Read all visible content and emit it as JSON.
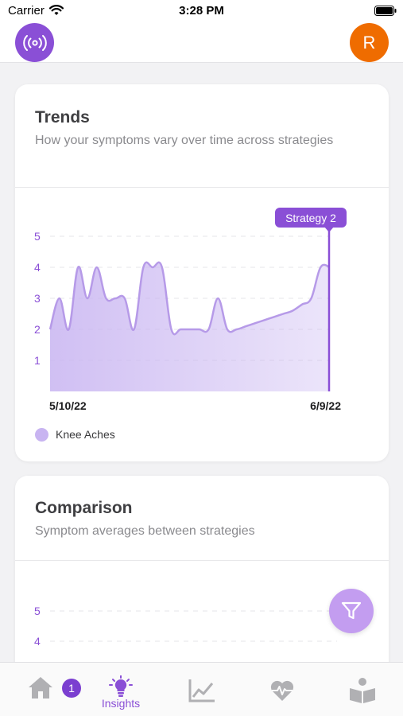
{
  "status_bar": {
    "carrier": "Carrier",
    "time": "3:28 PM"
  },
  "header": {
    "avatar_initial": "R"
  },
  "trends": {
    "title": "Trends",
    "subtitle": "How your symptoms vary over time across strategies",
    "legend_label": "Knee Aches",
    "colors": {
      "accent": "#8a4fd6",
      "area": "#c8b4f1",
      "line": "#b69ae8"
    }
  },
  "chart_data": [
    {
      "type": "area",
      "title": "",
      "x_start_label": "5/10/22",
      "x_end_label": "6/9/22",
      "x_tick_labels": [
        "5/10/22",
        "6/9/22"
      ],
      "y_ticks": [
        1,
        2,
        3,
        4,
        5
      ],
      "ylim": [
        0,
        5
      ],
      "grid": true,
      "series": [
        {
          "name": "Knee Aches",
          "x": [
            "5/10/22",
            "5/11/22",
            "5/12/22",
            "5/13/22",
            "5/14/22",
            "5/15/22",
            "5/16/22",
            "5/17/22",
            "5/18/22",
            "5/19/22",
            "5/20/22",
            "5/21/22",
            "5/22/22",
            "5/23/22",
            "5/24/22",
            "5/25/22",
            "5/26/22",
            "5/27/22",
            "5/28/22",
            "5/29/22",
            "5/30/22",
            "5/31/22",
            "6/1/22",
            "6/2/22",
            "6/3/22",
            "6/4/22",
            "6/5/22",
            "6/6/22",
            "6/7/22",
            "6/8/22",
            "6/9/22"
          ],
          "values": [
            2,
            3,
            2,
            4,
            3,
            4,
            3,
            3,
            3,
            2,
            4,
            4,
            4,
            2,
            2,
            2,
            2,
            2,
            3,
            2,
            2,
            2.1,
            2.2,
            2.3,
            2.4,
            2.5,
            2.6,
            2.8,
            3,
            4,
            4
          ]
        }
      ],
      "annotations": [
        {
          "label": "Strategy 2",
          "x": "6/9/22"
        }
      ]
    },
    {
      "type": "bar",
      "title": "",
      "y_ticks": [
        4,
        5
      ],
      "grid": true,
      "series": []
    }
  ],
  "comparison": {
    "title": "Comparison",
    "subtitle": "Symptom averages between strategies"
  },
  "tabs": [
    {
      "id": "home",
      "label": "",
      "badge": "1"
    },
    {
      "id": "insights",
      "label": "Insights"
    },
    {
      "id": "charts",
      "label": ""
    },
    {
      "id": "health",
      "label": ""
    },
    {
      "id": "learn",
      "label": ""
    }
  ]
}
